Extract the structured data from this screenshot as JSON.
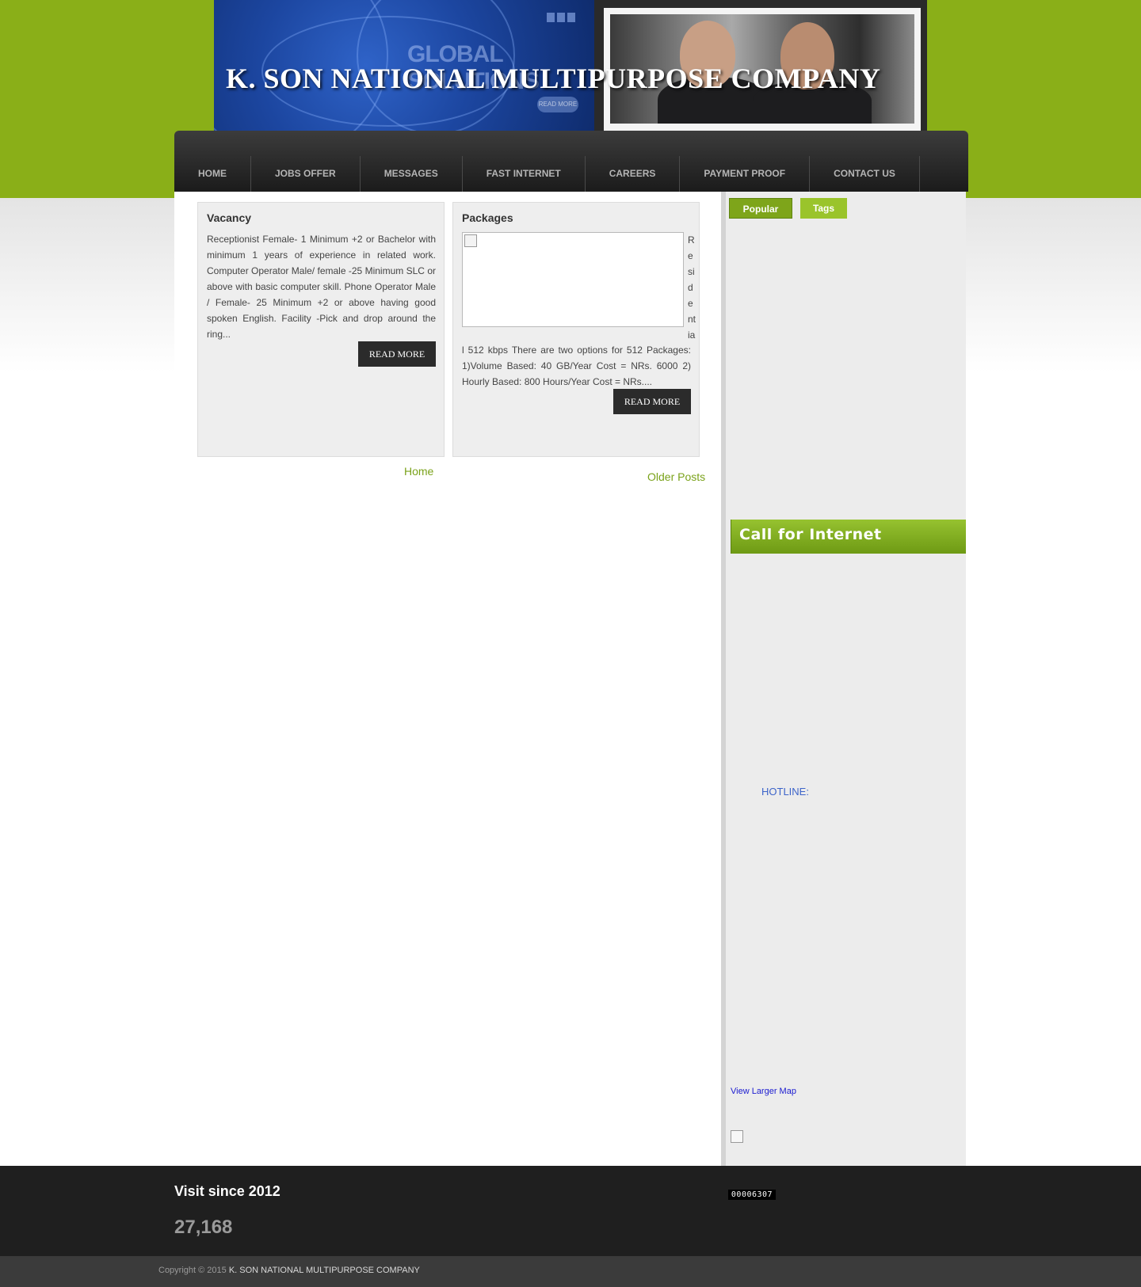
{
  "site": {
    "title": "K. SON NATIONAL MULTIPURPOSE COMPANY",
    "banner_watermark": "GLOBAL SOLUTIONS",
    "banner_button": "READ MORE"
  },
  "nav": {
    "items": [
      "HOME",
      "JOBS OFFER",
      "MESSAGES",
      "FAST INTERNET",
      "CAREERS",
      "PAYMENT PROOF",
      "CONTACT US"
    ]
  },
  "posts": [
    {
      "title": "Vacancy",
      "excerpt": "Receptionist Female- 1 Minimum +2 or Bachelor with minimum 1 years of experience in related work. Computer Operator Male/ female -25 Minimum SLC or above with basic computer skill. Phone Operator Male / Female- 25 Minimum +2 or above having good spoken English. Facility -Pick and drop around the ring...",
      "read_more": "READ MORE"
    },
    {
      "title": "Packages",
      "vertical_letters": [
        "R",
        "e",
        "si",
        "d",
        "e",
        "nt",
        "ia"
      ],
      "excerpt": "l 512 kbps There are two options for 512 Packages: 1)Volume Based: 40 GB/Year Cost = NRs. 6000 2) Hourly Based: 800 Hours/Year Cost = NRs....",
      "read_more": "READ MORE"
    }
  ],
  "pagination": {
    "home": "Home",
    "older": "Older Posts"
  },
  "sidebar": {
    "tabs": [
      "Popular",
      "Tags"
    ],
    "call_title": "Call for Internet",
    "hotline": "HOTLINE:",
    "map_link": "View Larger Map"
  },
  "footer": {
    "visit_title": "Visit since 2012",
    "visit_count": "27,168",
    "counter": "00006307",
    "copyright_prefix": "Copyright © 2015",
    "copyright_name": "K. SON NATIONAL MULTIPURPOSE COMPANY"
  },
  "colors": {
    "brand_green": "#8aaf18",
    "nav_dark": "#1b1b1b",
    "link_green": "#7aa21a"
  }
}
